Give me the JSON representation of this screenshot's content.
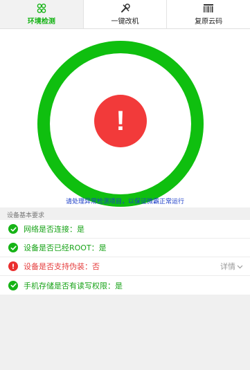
{
  "tabs": [
    {
      "label": "环境检测",
      "icon": "people-icon",
      "active": true
    },
    {
      "label": "一键改机",
      "icon": "tools-icon",
      "active": false
    },
    {
      "label": "复原云码",
      "icon": "barcode-icon",
      "active": false
    }
  ],
  "status_ring": {
    "alert_symbol": "!",
    "ring_color": "#0fbf0f",
    "alert_color": "#f23a3a"
  },
  "notice": "请处理异常检测项目，以保证微霸正常运行",
  "section_title": "设备基本要求",
  "checks": [
    {
      "text": "网络是否连接：是",
      "status": "ok"
    },
    {
      "text": "设备是否已经ROOT：是",
      "status": "ok"
    },
    {
      "text": "设备是否支持伪装：否",
      "status": "error",
      "detail": "详情"
    },
    {
      "text": "手机存储是否有读写权限：是",
      "status": "ok"
    }
  ],
  "colors": {
    "green": "#16b316",
    "red": "#ea2f2f",
    "blue": "#1a3cc7"
  }
}
